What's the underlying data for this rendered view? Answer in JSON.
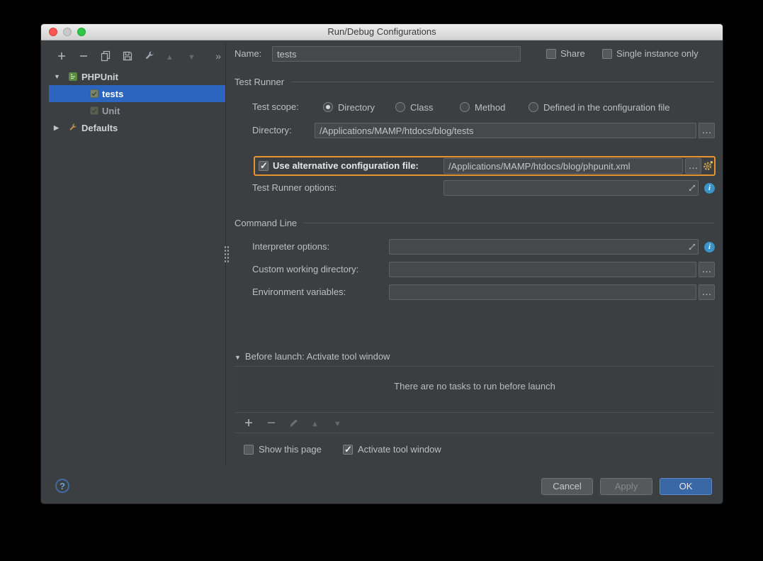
{
  "window": {
    "title": "Run/Debug Configurations"
  },
  "sidebar": {
    "overflow_chevron": "»",
    "tree": [
      {
        "label": "PHPUnit",
        "selected": false
      },
      {
        "label": "tests",
        "selected": true
      },
      {
        "label": "Unit",
        "selected": false
      },
      {
        "label": "Defaults",
        "selected": false
      }
    ]
  },
  "form": {
    "name": {
      "label": "Name:",
      "value": "tests"
    },
    "share": {
      "label": "Share",
      "checked": false
    },
    "single_instance": {
      "label": "Single instance only",
      "checked": false
    },
    "sections": {
      "test_runner": "Test Runner",
      "command_line": "Command Line"
    },
    "test_scope": {
      "label": "Test scope:",
      "options": [
        {
          "label": "Directory",
          "selected": true
        },
        {
          "label": "Class",
          "selected": false
        },
        {
          "label": "Method",
          "selected": false
        },
        {
          "label": "Defined in the configuration file",
          "selected": false
        }
      ]
    },
    "directory": {
      "label": "Directory:",
      "value": "/Applications/MAMP/htdocs/blog/tests",
      "browse": "…"
    },
    "alt_config": {
      "label": "Use alternative configuration file:",
      "checked": true,
      "value": "/Applications/MAMP/htdocs/blog/phpunit.xml",
      "browse": "…"
    },
    "test_runner_options": {
      "label": "Test Runner options:",
      "value": ""
    },
    "interpreter_options": {
      "label": "Interpreter options:",
      "value": ""
    },
    "custom_working_directory": {
      "label": "Custom working directory:",
      "value": "",
      "browse": "…"
    },
    "environment_variables": {
      "label": "Environment variables:",
      "value": "",
      "browse": "…"
    },
    "before_launch": {
      "label": "Before launch: Activate tool window",
      "empty_text": "There are no tasks to run before launch"
    },
    "show_this_page": {
      "label": "Show this page",
      "checked": false
    },
    "activate_tool_window": {
      "label": "Activate tool window",
      "checked": true
    }
  },
  "icons": {
    "info": "i",
    "help": "?"
  },
  "footer": {
    "cancel": "Cancel",
    "apply": "Apply",
    "ok": "OK"
  }
}
